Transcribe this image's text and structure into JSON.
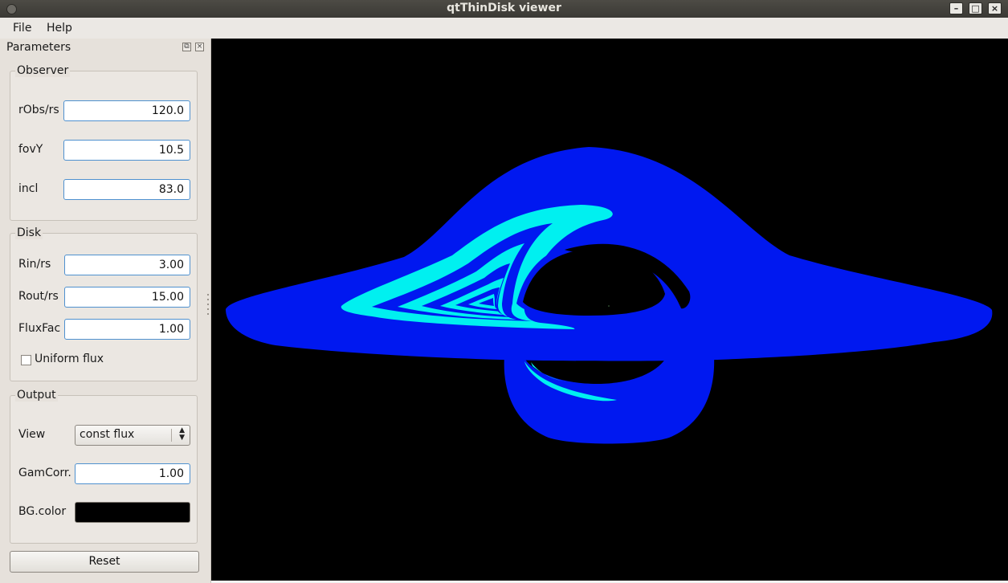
{
  "window": {
    "title": "qtThinDisk viewer"
  },
  "menu": {
    "file": "File",
    "help": "Help"
  },
  "panel": {
    "title": "Parameters",
    "observer": {
      "title": "Observer",
      "robs_label": "rObs/rs",
      "robs_value": "120.0",
      "fovy_label": "fovY",
      "fovy_value": "10.5",
      "incl_label": "incl",
      "incl_value": "83.0"
    },
    "disk": {
      "title": "Disk",
      "rin_label": "Rin/rs",
      "rin_value": "3.00",
      "rout_label": "Rout/rs",
      "rout_value": "15.00",
      "fluxfac_label": "FluxFac",
      "fluxfac_value": "1.00",
      "uniform_label": "Uniform flux",
      "uniform_checked": false
    },
    "output": {
      "title": "Output",
      "view_label": "View",
      "view_value": "const flux",
      "gamcorr_label": "GamCorr.",
      "gamcorr_value": "1.00",
      "bgcolor_label": "BG.color",
      "bgcolor_value": "#000000"
    },
    "reset_label": "Reset"
  },
  "colors": {
    "disk": "#0018f0",
    "bands": "#00f0f0",
    "background": "#000000"
  }
}
